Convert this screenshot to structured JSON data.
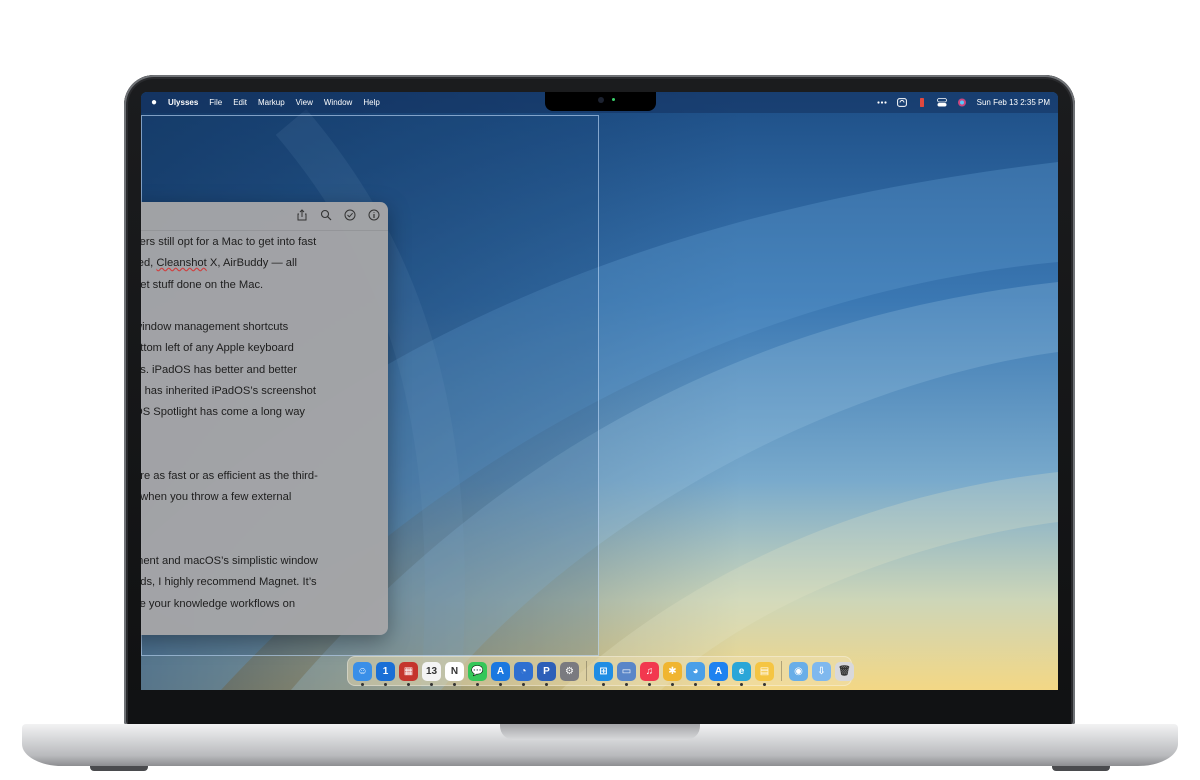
{
  "menubar": {
    "app_name": "Ulysses",
    "menus": [
      "File",
      "Edit",
      "Markup",
      "View",
      "Window",
      "Help"
    ],
    "clock": "Sun Feb 13  2:35 PM",
    "status_icons": [
      "more-icon",
      "sync-icon",
      "battery-bookmark-icon",
      "control-center-icon",
      "siri-icon"
    ]
  },
  "editor": {
    "toolbar_icons": [
      "share-icon",
      "search-icon",
      "goals-icon",
      "info-icon"
    ],
    "lines": [
      {
        "text": "sers still opt for a Mac to get into fast"
      },
      {
        "pre": "red, ",
        "spell": "Cleanshot",
        "post": " X, AirBuddy — all"
      },
      {
        "text": " get stuff done on the Mac."
      },
      {
        "text": ""
      },
      {
        "text": "window management shortcuts"
      },
      {
        "text": "ottom left of any Apple keyboard"
      },
      {
        "text": "es. iPadOS has better and better"
      },
      {
        "text": "S has inherited iPadOS’s screenshot"
      },
      {
        "text": "OS Spotlight has come a long way"
      },
      {
        "text": ""
      },
      {
        "text": ""
      },
      {
        "text": "are as fast or as efficient as the third-"
      },
      {
        "text": "t when you throw a few external"
      },
      {
        "text": ""
      },
      {
        "text": ""
      },
      {
        "text": "ment and macOS’s simplistic window"
      },
      {
        "text": "eds, I highly recommend Magnet. It’s"
      },
      {
        "text": "ve your knowledge workflows on"
      }
    ]
  },
  "dock": {
    "apps": [
      {
        "name": "finder-icon",
        "color": "#3a8fe8",
        "glyph": "☺"
      },
      {
        "name": "1password-icon",
        "color": "#1a6fd6",
        "glyph": "1"
      },
      {
        "name": "fantastical-icon",
        "color": "#c5352d",
        "glyph": "▦"
      },
      {
        "name": "calendar-icon",
        "color": "#f4f4f4",
        "glyph": "13"
      },
      {
        "name": "notion-icon",
        "color": "#ffffff",
        "glyph": "N"
      },
      {
        "name": "messages-icon",
        "color": "#35c759",
        "glyph": "💬"
      },
      {
        "name": "testflight-icon",
        "color": "#1b78e0",
        "glyph": "A"
      },
      {
        "name": "analytics-icon",
        "color": "#2e6fd1",
        "glyph": "◔"
      },
      {
        "name": "pockity-icon",
        "color": "#2d5fb8",
        "glyph": "P"
      },
      {
        "name": "system-preferences-icon",
        "color": "#7a7a80",
        "glyph": "⚙"
      },
      {
        "name": "sep"
      },
      {
        "name": "windows-app-icon",
        "color": "#1f8de4",
        "glyph": "⊞"
      },
      {
        "name": "preview-icon",
        "color": "#5a86c8",
        "glyph": "▭"
      },
      {
        "name": "music-icon",
        "color": "#f2384f",
        "glyph": "♫"
      },
      {
        "name": "tes-icon",
        "color": "#f0b530",
        "glyph": "✱"
      },
      {
        "name": "tweetbot-icon",
        "color": "#4a9fe8",
        "glyph": "◕"
      },
      {
        "name": "app-store-icon",
        "color": "#1e82f0",
        "glyph": "A"
      },
      {
        "name": "edge-icon",
        "color": "#2aa6d8",
        "glyph": "e"
      },
      {
        "name": "folder-app-icon",
        "color": "#f5c542",
        "glyph": "▤"
      },
      {
        "name": "sep"
      },
      {
        "name": "applications-folder-icon",
        "color": "#69aee8",
        "glyph": "◉"
      },
      {
        "name": "downloads-folder-icon",
        "color": "#7fb8ee",
        "glyph": "⇩"
      },
      {
        "name": "trash-icon",
        "color": "#d8d8dc",
        "glyph": "🗑"
      }
    ]
  }
}
